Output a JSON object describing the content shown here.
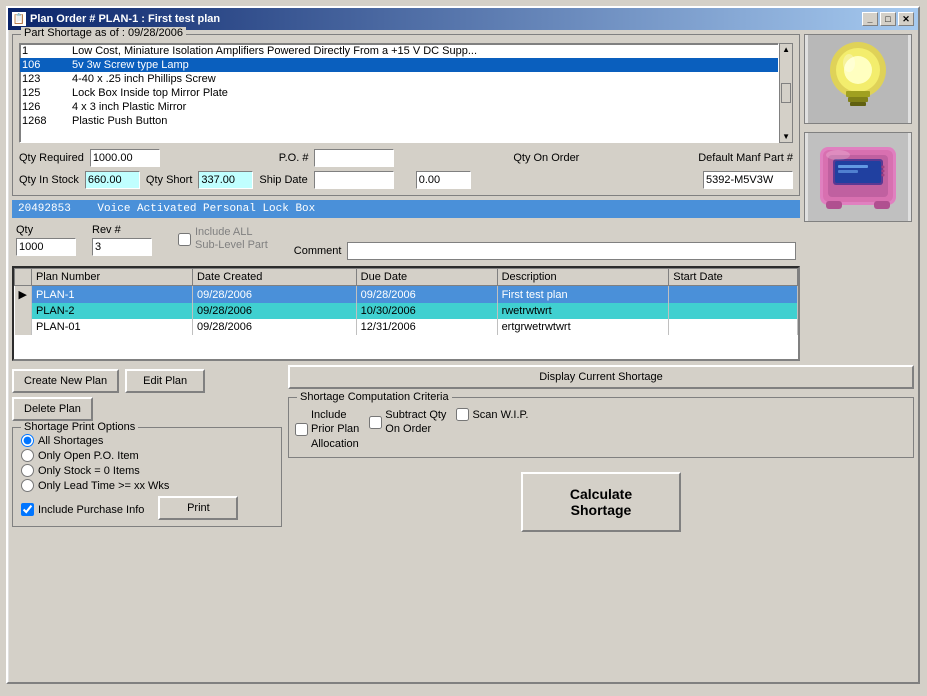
{
  "window": {
    "title": "Plan Order # PLAN-1 : First test plan",
    "icon": "📋"
  },
  "title_buttons": {
    "minimize": "_",
    "maximize": "□",
    "close": "✕"
  },
  "part_shortage": {
    "group_label": "Part Shortage as of : 09/28/2006",
    "parts": [
      {
        "num": "1",
        "desc": "Low Cost, Miniature Isolation Amplifiers Powered Directly From a +15 V DC Supp..."
      },
      {
        "num": "106",
        "desc": "5v 3w Screw type Lamp"
      },
      {
        "num": "123",
        "desc": "4-40 x .25 inch Phillips Screw"
      },
      {
        "num": "125",
        "desc": "Lock Box Inside top Mirror Plate"
      },
      {
        "num": "126",
        "desc": "4 x 3 inch Plastic Mirror"
      },
      {
        "num": "1268",
        "desc": "Plastic Push Button"
      }
    ],
    "selected_index": 1
  },
  "qty_section": {
    "qty_required_label": "Qty Required",
    "qty_required_value": "1000.00",
    "qty_in_stock_label": "Qty In Stock",
    "qty_in_stock_value": "660.00",
    "qty_short_label": "Qty Short",
    "qty_short_value": "337.00",
    "po_label": "P.O. #",
    "po_value": "",
    "ship_date_label": "Ship Date",
    "ship_date_value": "",
    "qty_on_order_label": "Qty On Order",
    "qty_on_order_value": "0.00",
    "default_manf_label": "Default Manf Part #",
    "default_manf_value": "5392-M5V3W"
  },
  "detail_bar": {
    "part_number": "20492853",
    "description": "Voice Activated Personal  Lock Box"
  },
  "order_section": {
    "qty_label": "Qty",
    "qty_value": "1000",
    "rev_label": "Rev #",
    "rev_value": "3",
    "include_all_label": "Include ALL",
    "sub_level_label": "Sub-Level Part",
    "comment_label": "Comment"
  },
  "plan_table": {
    "columns": [
      "",
      "Plan Number",
      "Date Created",
      "Due Date",
      "Description",
      "Start Date"
    ],
    "rows": [
      {
        "arrow": "▶",
        "plan_number": "PLAN-1",
        "date_created": "09/28/2006",
        "due_date": "09/28/2006",
        "description": "First test plan",
        "start_date": "",
        "style": "selected1"
      },
      {
        "arrow": "",
        "plan_number": "PLAN-2",
        "date_created": "09/28/2006",
        "due_date": "10/30/2006",
        "description": "rwetrwtwrt",
        "start_date": "",
        "style": "selected2"
      },
      {
        "arrow": "",
        "plan_number": "PLAN-01",
        "date_created": "09/28/2006",
        "due_date": "12/31/2006",
        "description": "ertgrwetrwtwrt",
        "start_date": "",
        "style": "current"
      }
    ]
  },
  "buttons": {
    "create_new_plan": "Create New  Plan",
    "edit_plan": "Edit Plan",
    "delete_plan": "Delete Plan",
    "display_current_shortage": "Display Current Shortage",
    "calculate_shortage": "Calculate\nShortage",
    "print": "Print"
  },
  "shortage_criteria": {
    "group_label": "Shortage Computation Criteria",
    "include_prior_label": "Include\nPrior Plan\nAllocation",
    "subtract_qty_label": "Subtract Qty\nOn Order",
    "scan_wip_label": "Scan W.I.P.",
    "include_prior_checked": false,
    "subtract_qty_checked": false,
    "scan_wip_checked": false
  },
  "print_options": {
    "group_label": "Shortage Print Options",
    "options": [
      {
        "id": "all",
        "label": "All Shortages",
        "selected": true
      },
      {
        "id": "open_po",
        "label": "Only Open P.O. Item",
        "selected": false
      },
      {
        "id": "stock_zero",
        "label": "Only Stock = 0  Items",
        "selected": false
      },
      {
        "id": "lead_time",
        "label": "Only Lead Time >= xx Wks",
        "selected": false
      }
    ],
    "include_purchase_label": "Include Purchase Info",
    "include_purchase_checked": true
  }
}
